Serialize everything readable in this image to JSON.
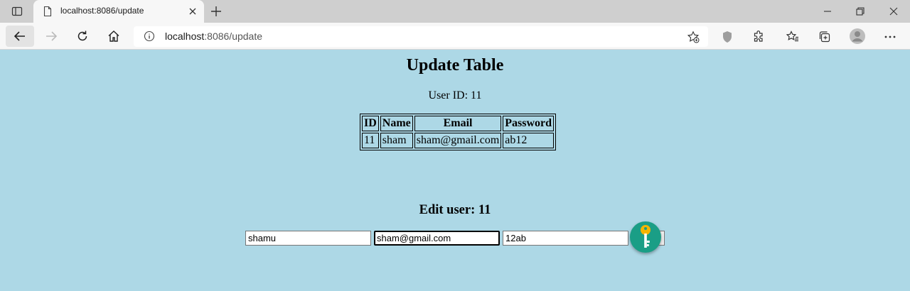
{
  "browser": {
    "tab_title": "localhost:8086/update",
    "url_host": "localhost",
    "url_path": ":8086/update"
  },
  "page": {
    "heading": "Update Table",
    "user_id_line": "User ID: 11",
    "table": {
      "headers": [
        "ID",
        "Name",
        "Email",
        "Password"
      ],
      "rows": [
        [
          "11",
          "sham",
          "sham@gmail.com",
          "ab12"
        ]
      ]
    },
    "edit_title": "Edit user: 11",
    "form": {
      "name_value": "shamu",
      "email_value": "sham@gmail.com",
      "password_value": "12ab"
    }
  },
  "colors": {
    "page_background": "#add8e6",
    "key_badge": "#1a9e86",
    "key_color": "#f5b400"
  }
}
